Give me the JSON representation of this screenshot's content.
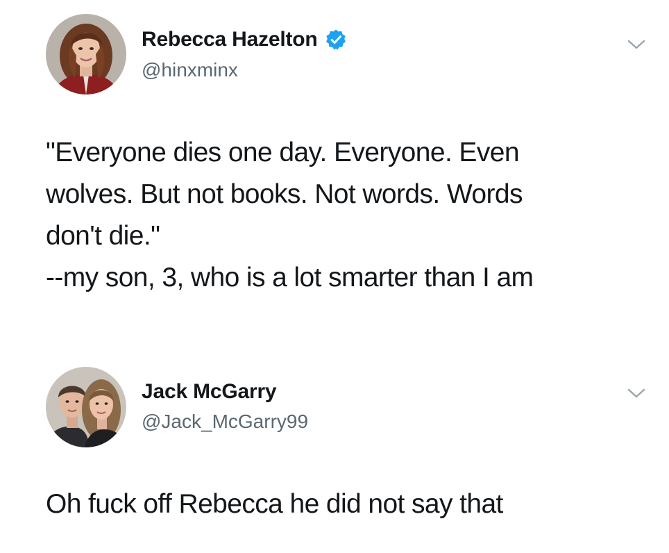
{
  "tweets": [
    {
      "author": {
        "display_name": "Rebecca Hazelton",
        "handle": "@hinxminx",
        "verified": true,
        "avatar_icon": "profile-photo-woman"
      },
      "text_lines": [
        "\"Everyone dies one day. Everyone. Even",
        "wolves. But not books. Not words. Words",
        "don't die.\"",
        "--my son, 3, who is a lot smarter than I am"
      ],
      "menu_icon": "chevron-down-icon"
    },
    {
      "author": {
        "display_name": "Jack McGarry",
        "handle": "@Jack_McGarry99",
        "verified": false,
        "avatar_icon": "profile-photo-couple"
      },
      "text_lines": [
        "Oh fuck off Rebecca he did not say that"
      ],
      "menu_icon": "chevron-down-icon"
    }
  ],
  "colors": {
    "text": "#14171a",
    "handle": "#5b6770",
    "verified_badge": "#1da1f2",
    "caret": "#9aa4ad"
  }
}
